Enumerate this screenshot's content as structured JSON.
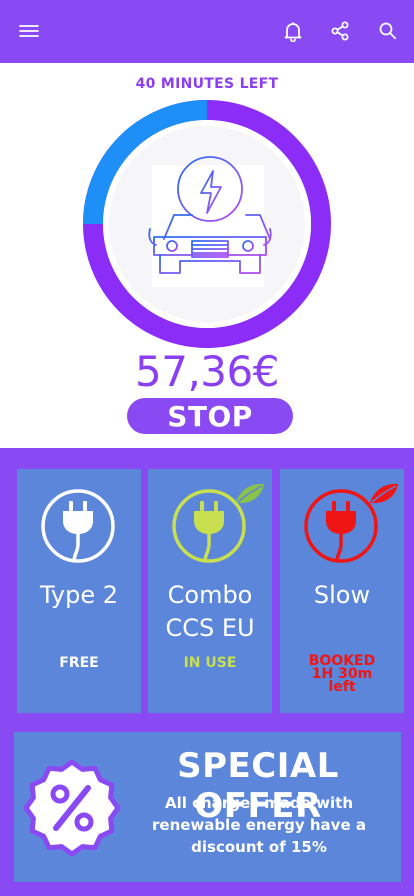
{
  "colors": {
    "accent": "#8a4af3",
    "card": "#5b86d9",
    "in_use": "#c8e04f",
    "booked": "#f01515",
    "ring_blue": "#1e8ff7",
    "ring_purple": "#8b2cf7"
  },
  "header": {
    "menu_icon": "hamburger-menu-icon",
    "icons": [
      "bell-icon",
      "share-icon",
      "search-icon"
    ]
  },
  "session": {
    "time_left": "40 MINUTES LEFT",
    "progress": 0.25,
    "price": "57,36€",
    "stop_label": "STOP"
  },
  "connectors": [
    {
      "name_line1": "Type 2",
      "name_line2": "",
      "status_line1": "FREE",
      "status_line2": "",
      "status_line3": "",
      "color": "#ffffff",
      "status_color": "#ffffff"
    },
    {
      "name_line1": "Combo",
      "name_line2": "CCS EU",
      "status_line1": "IN USE",
      "status_line2": "",
      "status_line3": "",
      "color": "#c8e04f",
      "status_color": "#c8e04f"
    },
    {
      "name_line1": "Slow",
      "name_line2": "",
      "status_line1": "BOOKED",
      "status_line2": "1H 30m",
      "status_line3": "left",
      "color": "#f01515",
      "status_color": "#f01515"
    }
  ],
  "offer": {
    "title": "SPECIAL OFFER",
    "line1": "All charges made with",
    "line2": "renewable energy have  a",
    "line3": "discount of 15%"
  }
}
